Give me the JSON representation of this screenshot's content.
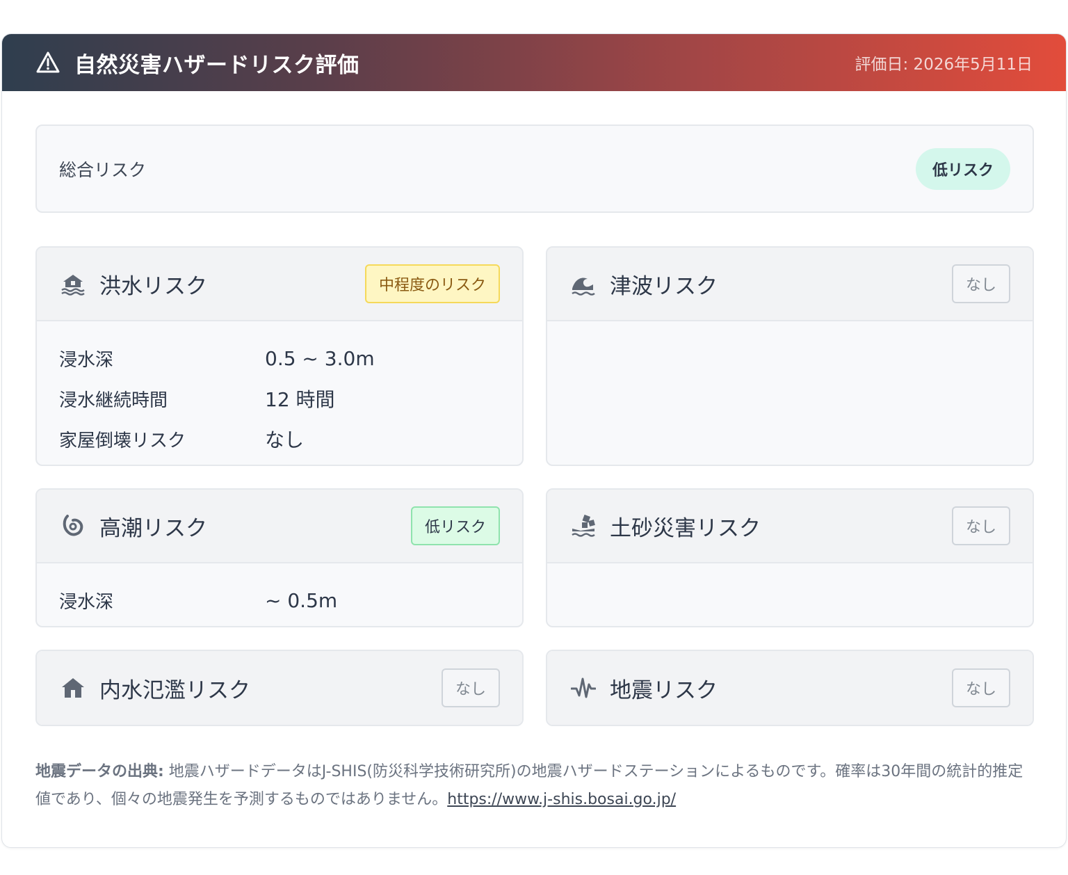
{
  "header": {
    "title": "自然災害ハザードリスク評価",
    "date": "評価日: 2026年5月11日",
    "icon": "warning-triangle-icon"
  },
  "overall": {
    "label": "総合リスク",
    "badge": "低リスク"
  },
  "risks": {
    "flood": {
      "title": "洪水リスク",
      "icon": "flood-house-icon",
      "badge": "中程度のリスク",
      "rows": [
        {
          "label": "浸水深",
          "value": "0.5 ~ 3.0m"
        },
        {
          "label": "浸水継続時間",
          "value": "12 時間"
        },
        {
          "label": "家屋倒壊リスク",
          "value": "なし"
        }
      ]
    },
    "tsunami": {
      "title": "津波リスク",
      "icon": "wave-icon",
      "badge": "なし"
    },
    "storm_surge": {
      "title": "高潮リスク",
      "icon": "hurricane-icon",
      "badge": "低リスク",
      "rows": [
        {
          "label": "浸水深",
          "value": "~ 0.5m"
        }
      ]
    },
    "landslide": {
      "title": "土砂災害リスク",
      "icon": "landslide-icon",
      "badge": "なし"
    },
    "inland_flood": {
      "title": "内水氾濫リスク",
      "icon": "house-icon",
      "badge": "なし"
    },
    "earthquake": {
      "title": "地震リスク",
      "icon": "seismic-wave-icon",
      "badge": "なし"
    }
  },
  "footnote": {
    "label": "地震データの出典:",
    "text": " 地震ハザードデータはJ-SHIS(防災科学技術研究所)の地震ハザードステーションによるものです。確率は30年間の統計的推定値であり、個々の地震発生を予測するものではありません。",
    "link": "https://www.j-shis.bosai.go.jp/"
  },
  "colors": {
    "header_start": "#2f3e4e",
    "header_end": "#e24c3b",
    "badge_low_bg": "#d4f7ec",
    "badge_mid_bg": "#fef6c3",
    "badge_mid_border": "#f5d95a"
  }
}
